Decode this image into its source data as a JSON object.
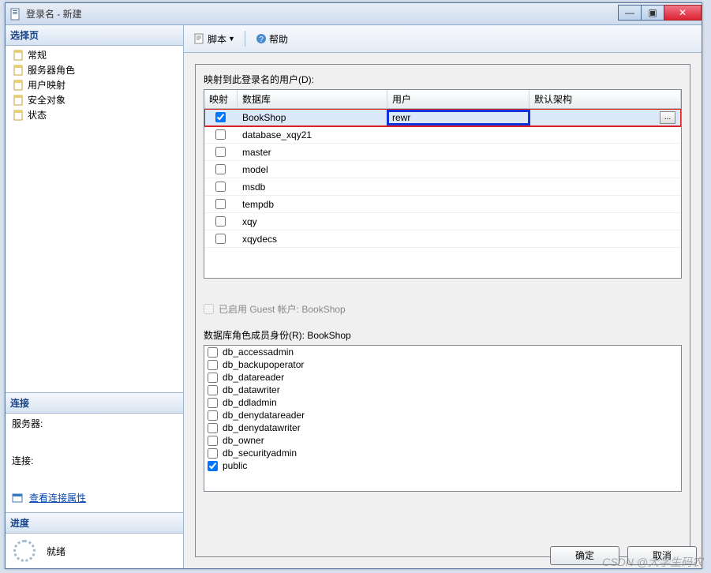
{
  "window": {
    "title": "登录名 - 新建"
  },
  "winbuttons": {
    "min": "—",
    "max": "▣",
    "close": "✕"
  },
  "sidebar": {
    "header": "选择页",
    "items": [
      {
        "label": "常规"
      },
      {
        "label": "服务器角色"
      },
      {
        "label": "用户映射"
      },
      {
        "label": "安全对象"
      },
      {
        "label": "状态"
      }
    ],
    "connection": {
      "header": "连接",
      "server_label": "服务器:",
      "conn_label": "连接:",
      "viewprops": "查看连接属性"
    },
    "progress": {
      "header": "进度",
      "status": "就绪"
    }
  },
  "toolbar": {
    "script": "脚本",
    "help": "帮助"
  },
  "main": {
    "mapping_label": "映射到此登录名的用户(D):",
    "columns": {
      "map": "映射",
      "db": "数据库",
      "user": "用户",
      "schema": "默认架构"
    },
    "rows": [
      {
        "checked": true,
        "db": "BookShop",
        "user": "rewr",
        "selected": true
      },
      {
        "checked": false,
        "db": "database_xqy21",
        "user": ""
      },
      {
        "checked": false,
        "db": "master",
        "user": ""
      },
      {
        "checked": false,
        "db": "model",
        "user": ""
      },
      {
        "checked": false,
        "db": "msdb",
        "user": ""
      },
      {
        "checked": false,
        "db": "tempdb",
        "user": ""
      },
      {
        "checked": false,
        "db": "xqy",
        "user": ""
      },
      {
        "checked": false,
        "db": "xqydecs",
        "user": ""
      }
    ],
    "guest": "已启用 Guest 帐户: BookShop",
    "roles_label": "数据库角色成员身份(R): BookShop",
    "roles": [
      {
        "name": "db_accessadmin",
        "checked": false
      },
      {
        "name": "db_backupoperator",
        "checked": false
      },
      {
        "name": "db_datareader",
        "checked": false
      },
      {
        "name": "db_datawriter",
        "checked": false
      },
      {
        "name": "db_ddladmin",
        "checked": false
      },
      {
        "name": "db_denydatareader",
        "checked": false
      },
      {
        "name": "db_denydatawriter",
        "checked": false
      },
      {
        "name": "db_owner",
        "checked": false
      },
      {
        "name": "db_securityadmin",
        "checked": false
      },
      {
        "name": "public",
        "checked": true
      }
    ]
  },
  "buttons": {
    "ok": "确定",
    "cancel": "取消"
  },
  "watermark": "CSDN @大学生码农"
}
